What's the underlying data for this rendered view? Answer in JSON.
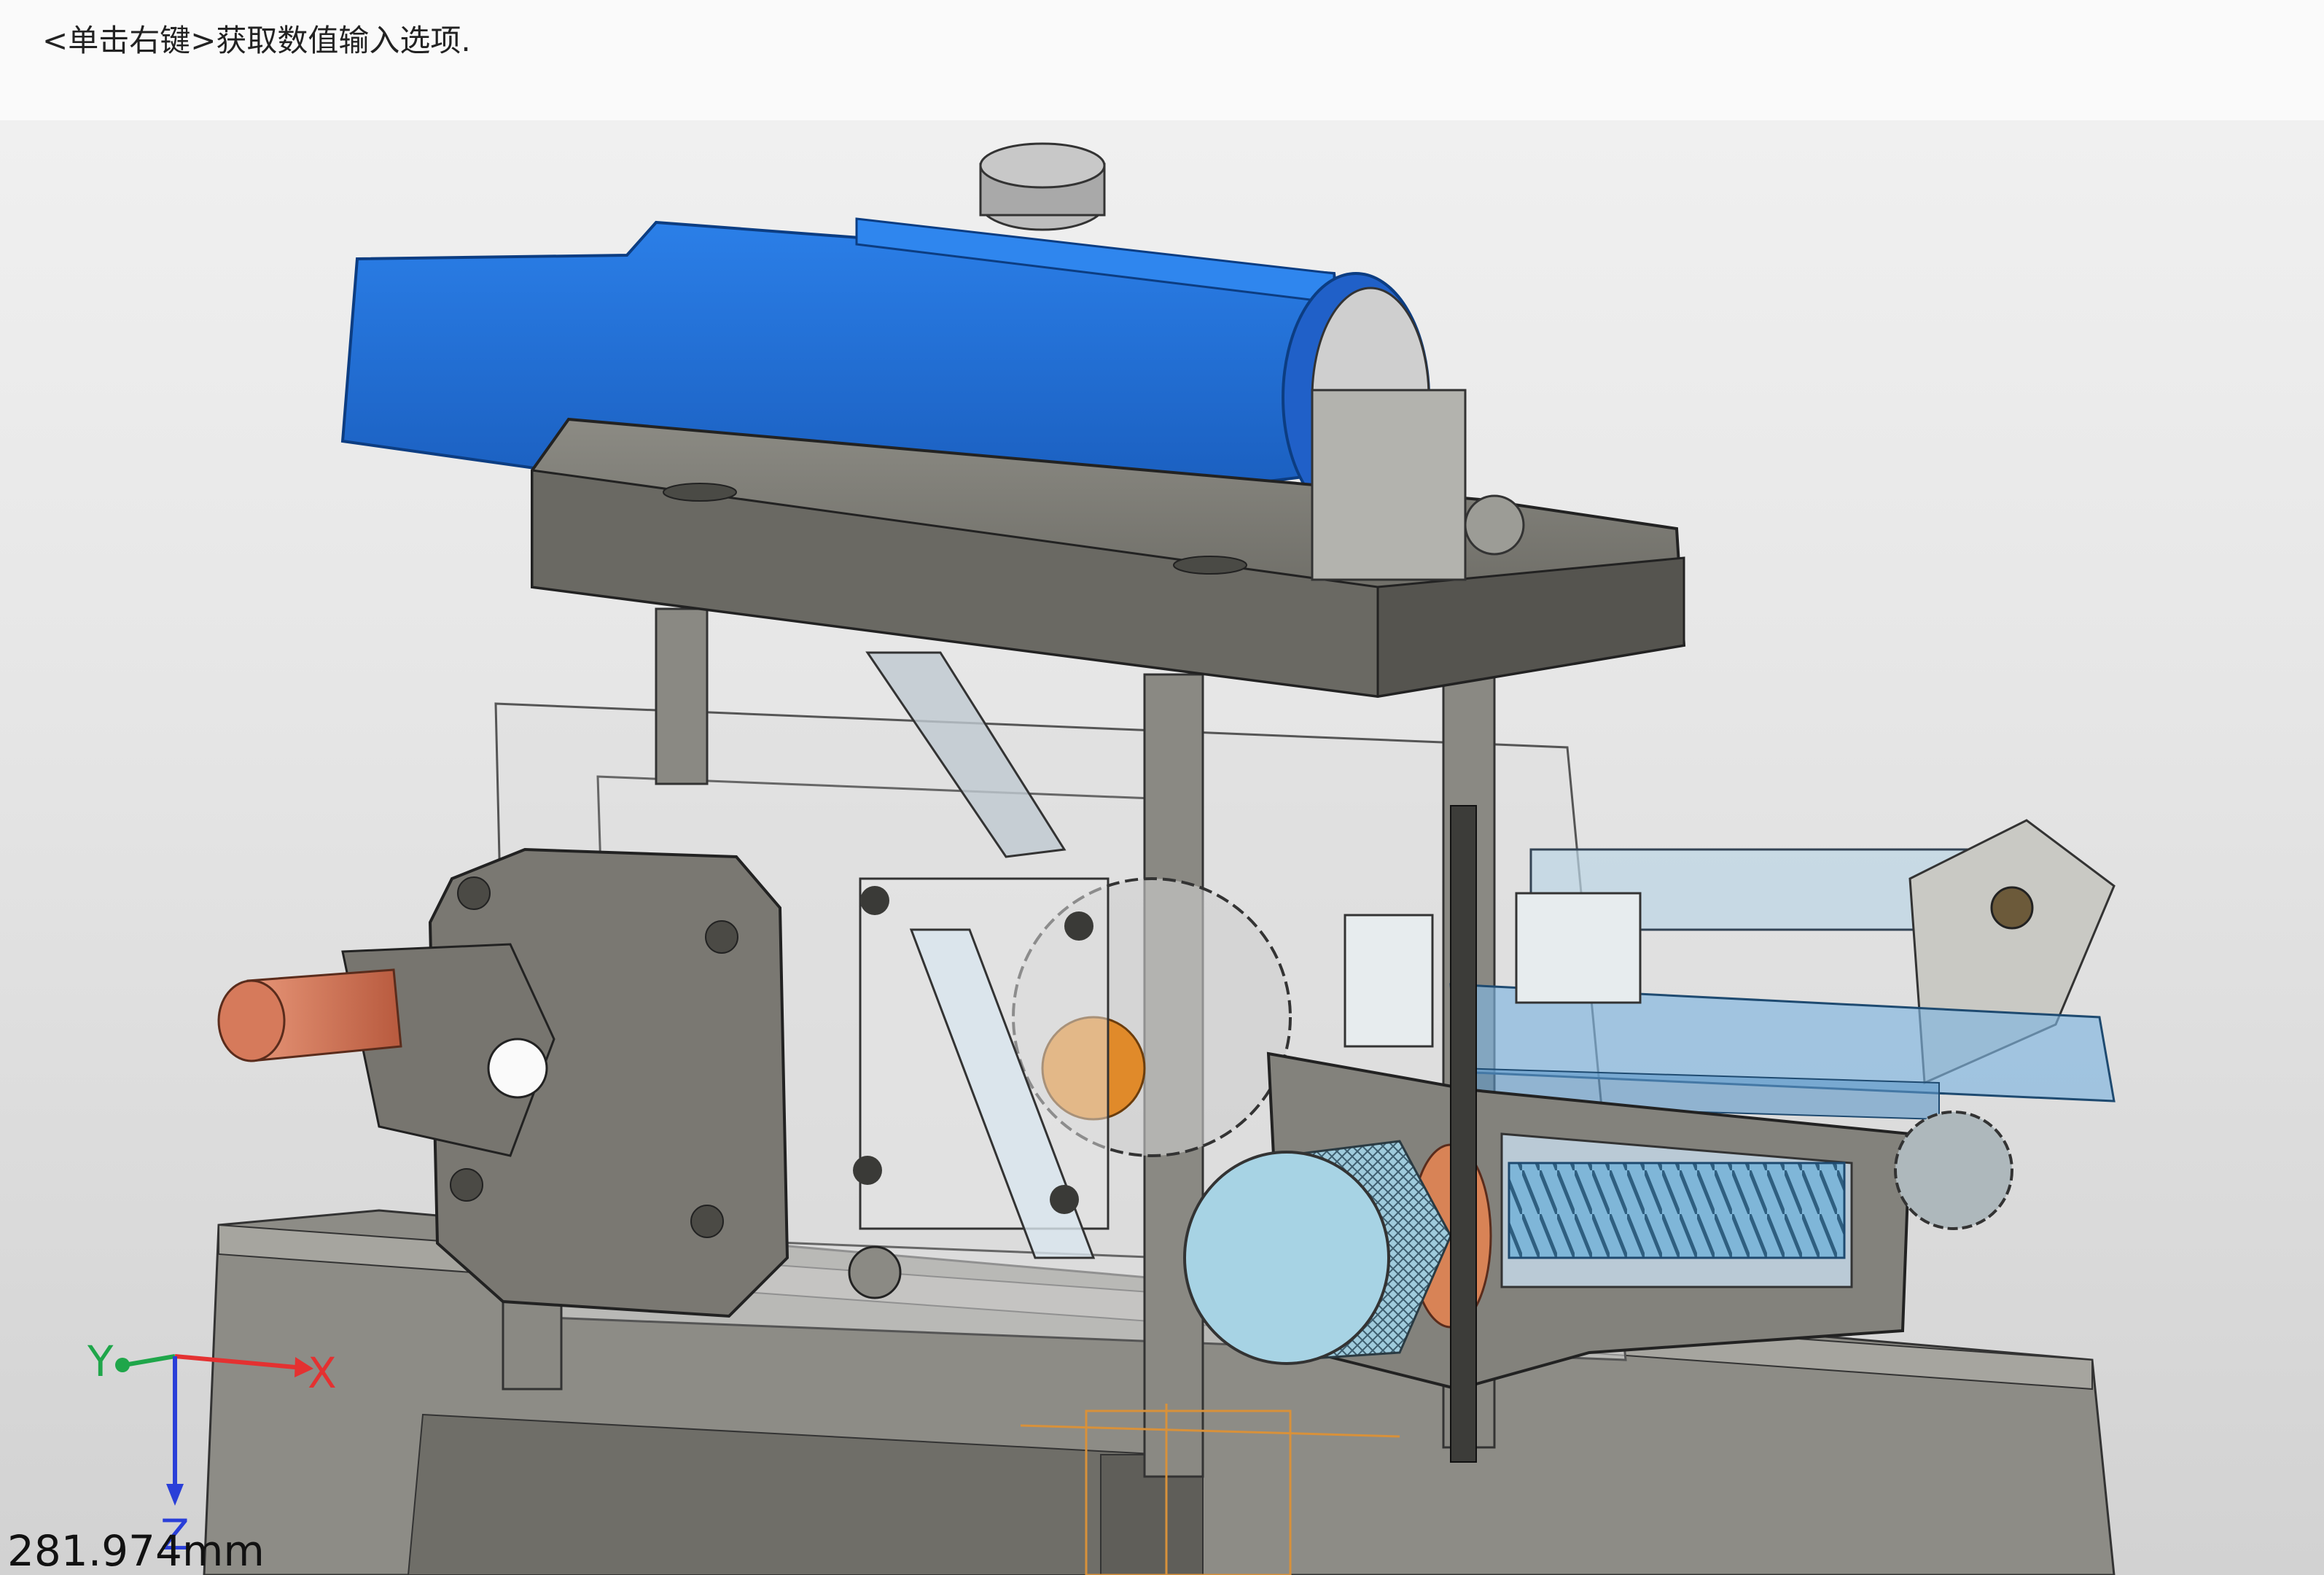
{
  "prompt": {
    "text": "<单击右键>获取数值输入选项."
  },
  "viewport": {
    "axes": {
      "x_label": "X",
      "y_label": "Y",
      "z_label": "Z"
    },
    "measurement": "281.974mm",
    "colors": {
      "blue_part": "#1f6fd8",
      "gray_part": "#7b7a73",
      "copper_shaft": "#d8785a",
      "orange_bearing": "#e08a2a",
      "knob": "#a7d3e4",
      "transparent_blue": "#7fb5e0"
    }
  }
}
